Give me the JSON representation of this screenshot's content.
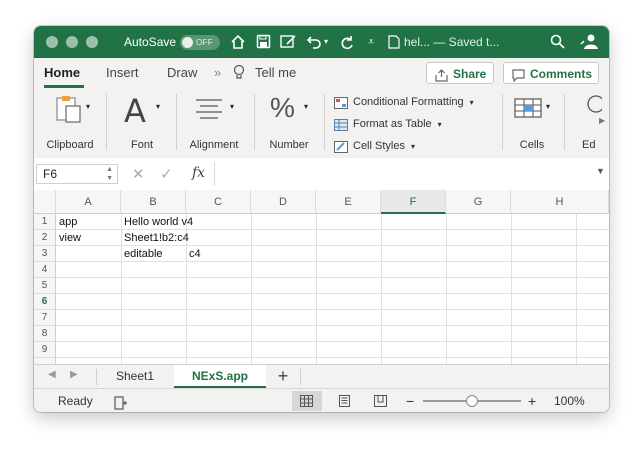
{
  "titlebar": {
    "autosave_label": "AutoSave",
    "autosave_state": "OFF",
    "doc_title": "hel... — Saved t...",
    "accent_color": "#217346"
  },
  "tabs": {
    "items": [
      "Home",
      "Insert",
      "Draw"
    ],
    "more_chevron": "»",
    "tell_me": "Tell me",
    "share": "Share",
    "comments": "Comments"
  },
  "ribbon": {
    "clipboard": "Clipboard",
    "font": "Font",
    "alignment": "Alignment",
    "number": "Number",
    "conditional_formatting": "Conditional Formatting",
    "format_as_table": "Format as Table",
    "cell_styles": "Cell Styles",
    "cells": "Cells",
    "editing_partial": "Ed"
  },
  "formula_bar": {
    "name_box": "F6",
    "fx": "fx",
    "value": ""
  },
  "grid": {
    "columns": [
      "A",
      "B",
      "C",
      "D",
      "E",
      "F",
      "G",
      "H"
    ],
    "selected_column": "F",
    "rows": [
      "1",
      "2",
      "3",
      "4",
      "5",
      "6",
      "7",
      "8",
      "9"
    ],
    "selected_row": "6",
    "cells": {
      "A1": "app",
      "B1": "Hello world v4",
      "A2": "view",
      "B2": "Sheet1!b2:c4",
      "B3": "editable",
      "C3": "c4"
    }
  },
  "sheets": {
    "tabs": [
      "Sheet1",
      "NExS.app"
    ],
    "active": "NExS.app",
    "add": "+"
  },
  "status": {
    "ready": "Ready",
    "zoom": "100%",
    "zoom_fraction": 0.5,
    "minus": "−",
    "plus": "+"
  }
}
